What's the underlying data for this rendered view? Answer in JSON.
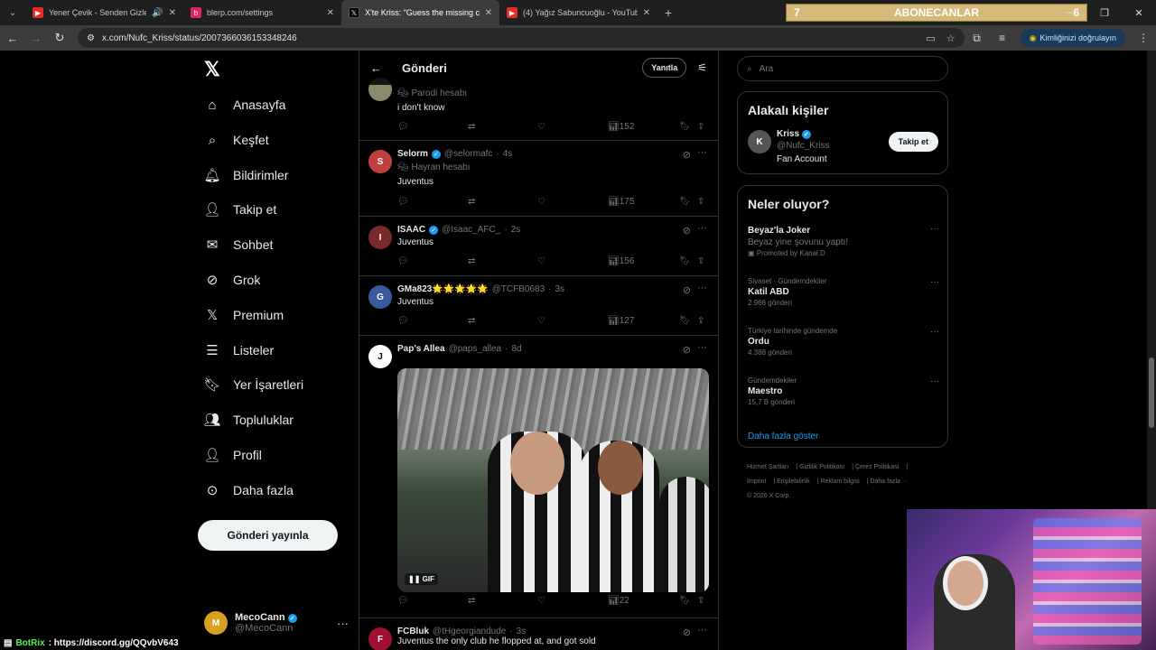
{
  "browser": {
    "tabs": [
      {
        "title": "Yener Çevik - Senden Gizle",
        "favicon_color": "#e52d27",
        "active": false
      },
      {
        "title": "blerp.com/settings",
        "favicon_color": "#e0245e",
        "active": false
      },
      {
        "title": "X'te Kriss: \"Guess the missing c",
        "favicon_color": "#000000",
        "active": true
      },
      {
        "title": "(4) Yağız Sabuncuoğlu - YouTub",
        "favicon_color": "#e52d27",
        "active": false
      }
    ],
    "url": "x.com/Nufc_Kriss/status/2007366036153348246",
    "verify_label": "Kimliğinizi doğrulayın"
  },
  "overlay": {
    "left_num": "7",
    "title": "ABONECANLAR",
    "right_num": "6"
  },
  "nav": {
    "items": [
      {
        "label": "Anasayfa",
        "icon": "home-icon"
      },
      {
        "label": "Keşfet",
        "icon": "search-icon"
      },
      {
        "label": "Bildirimler",
        "icon": "bell-icon"
      },
      {
        "label": "Takip et",
        "icon": "add-person-icon"
      },
      {
        "label": "Sohbet",
        "icon": "mail-icon"
      },
      {
        "label": "Grok",
        "icon": "grok-icon"
      },
      {
        "label": "Premium",
        "icon": "x-logo-icon"
      },
      {
        "label": "Listeler",
        "icon": "list-icon"
      },
      {
        "label": "Yer İşaretleri",
        "icon": "bookmark-icon"
      },
      {
        "label": "Topluluklar",
        "icon": "communities-icon"
      },
      {
        "label": "Profil",
        "icon": "person-icon"
      },
      {
        "label": "Daha fazla",
        "icon": "more-circle-icon"
      }
    ],
    "post_button": "Gönderi yayınla",
    "me": {
      "name": "MecoCann",
      "handle": "@MecoCann"
    }
  },
  "main": {
    "title": "Gönderi",
    "reply_button": "Yanıtla",
    "tweets": [
      {
        "name": "",
        "handle": "",
        "time": "",
        "label": "Parodi hesabı",
        "text": "i don't know",
        "views": "152"
      },
      {
        "name": "Selorm",
        "handle": "@selormafc",
        "time": "4s",
        "label": "Hayran hesabı",
        "text": "Juventus",
        "views": "175"
      },
      {
        "name": "ISAAC",
        "handle": "@Isaac_AFC_",
        "time": "2s",
        "label": "",
        "text": "Juventus",
        "views": "156"
      },
      {
        "name": "GMa823🌟🌟🌟🌟🌟",
        "handle": "@TCFB0683",
        "time": "3s",
        "label": "",
        "text": "Juventus",
        "views": "127"
      },
      {
        "name": "Pap's Allea",
        "handle": "@paps_allea",
        "time": "8d",
        "label": "",
        "text": "",
        "views": "22",
        "media_badge": "GIF"
      },
      {
        "name": "FCBluk",
        "handle": "@tHgeorgiandude",
        "time": "3s",
        "label": "",
        "text": "Juventus the only club he flopped at, and got sold"
      }
    ]
  },
  "sidebar": {
    "search_placeholder": "Ara",
    "people_title": "Alakalı kişiler",
    "person": {
      "name": "Kriss",
      "handle": "@Nufc_Kriss",
      "bio": "Fan Account",
      "follow_button": "Takip et"
    },
    "trends_title": "Neler oluyor?",
    "trends": [
      {
        "category": "",
        "name": "Beyaz'la Joker",
        "sub": "Beyaz yine şovunu yaptı!",
        "count": "Promoted by Kanal D"
      },
      {
        "category": "Siyaset · Gündemdekiler",
        "name": "Katil ABD",
        "sub": "",
        "count": "2.966 gönderi"
      },
      {
        "category": "Türkiye tarihinde gündemde",
        "name": "Ordu",
        "sub": "",
        "count": "4.388 gönderi"
      },
      {
        "category": "Gündemdekiler",
        "name": "Maestro",
        "sub": "",
        "count": "15,7 B gönderi"
      }
    ],
    "show_more": "Daha fazla göster",
    "footer": [
      "Hizmet Şartları",
      "Gizlilik Politikası",
      "Çerez Politikası",
      "Imprint",
      "Erişilebilirlik",
      "Reklam bilgisi",
      "Daha fazla ···",
      "© 2026 X Corp."
    ]
  },
  "stream": {
    "bot_name": "BotRix",
    "bot_text": ": https://discord.gg/QQvbV643"
  }
}
